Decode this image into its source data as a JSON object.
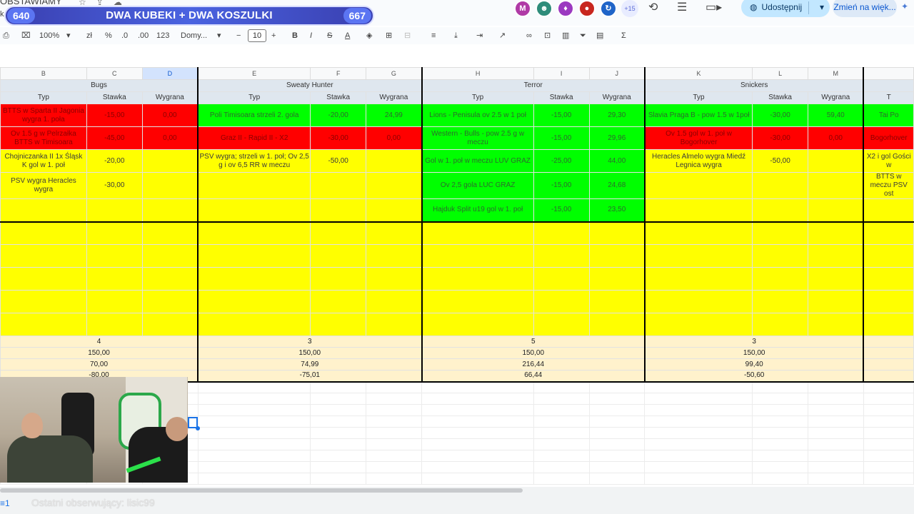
{
  "doc": {
    "title": "OBSTAWIAMY",
    "title_sub": "k"
  },
  "banner": {
    "left_num": "640",
    "text": "DWA KUBEKI + DWA KOSZULKI",
    "right_num": "667"
  },
  "collab": {
    "avatars": [
      {
        "letter": "M",
        "color": "#b03aa6"
      },
      {
        "letter": "☻",
        "color": "#2e8c7a"
      },
      {
        "letter": "♦",
        "color": "#9b39c0"
      },
      {
        "letter": "●",
        "color": "#c8261e"
      },
      {
        "letter": "↻",
        "color": "#1f64c8"
      }
    ],
    "more": "+15"
  },
  "header_actions": {
    "share_label": "Udostępnij",
    "change_label": "Zmień na więk..."
  },
  "toolbar": {
    "zoom": "100%",
    "currency": "zł",
    "percent": "%",
    "dec_less": ".0",
    "dec_more": ".00",
    "number_format": "123",
    "font": "Domy...",
    "font_size": "10",
    "bold": "B",
    "italic": "I",
    "strike": "S",
    "text_color": "A",
    "sigma": "Σ"
  },
  "columns": [
    "B",
    "C",
    "D",
    "E",
    "F",
    "G",
    "H",
    "I",
    "J",
    "K",
    "L",
    "M"
  ],
  "blocks": [
    {
      "name": "Bugs"
    },
    {
      "name": "Sweaty Hunter"
    },
    {
      "name": "Terror"
    },
    {
      "name": "Snickers"
    }
  ],
  "sub_headers": {
    "typ": "Typ",
    "stawka": "Stawka",
    "wygrana": "Wygrana",
    "next_partial": "T"
  },
  "bets": [
    {
      "cells": [
        {
          "t": "BTTS w Sparta II Jagonia wygra 1. poła",
          "c": "r"
        },
        {
          "t": "-15,00",
          "c": "r"
        },
        {
          "t": "0,00",
          "c": "r"
        },
        {
          "t": "Poli Timisoara strzeli 2. gola",
          "c": "g"
        },
        {
          "t": "-20,00",
          "c": "g"
        },
        {
          "t": "24,99",
          "c": "g"
        },
        {
          "t": "Lions - Penisula ov 2.5 w  1 poł",
          "c": "g"
        },
        {
          "t": "-15,00",
          "c": "g"
        },
        {
          "t": "29,30",
          "c": "g"
        },
        {
          "t": "Slavia Praga B - pow 1.5 w  1poł",
          "c": "g"
        },
        {
          "t": "-30,00",
          "c": "g"
        },
        {
          "t": "59,40",
          "c": "g"
        },
        {
          "t": "Tai Po",
          "c": "g"
        }
      ]
    },
    {
      "cells": [
        {
          "t": "Ov 1.5 g w Pelrzałka BTTS w Timisoara",
          "c": "r"
        },
        {
          "t": "-45,00",
          "c": "r"
        },
        {
          "t": "0,00",
          "c": "r"
        },
        {
          "t": "Graz II - Rapid II - X2",
          "c": "r"
        },
        {
          "t": "-30,00",
          "c": "r"
        },
        {
          "t": "0,00",
          "c": "r"
        },
        {
          "t": "Western - Bulls - pow 2.5 g w meczu",
          "c": "g"
        },
        {
          "t": "-15,00",
          "c": "g"
        },
        {
          "t": "29,96",
          "c": "g"
        },
        {
          "t": "Ov 1.5 gol w 1. poł w Bogorhover",
          "c": "r"
        },
        {
          "t": "-30,00",
          "c": "r"
        },
        {
          "t": "0,00",
          "c": "r"
        },
        {
          "t": "Bogorhover",
          "c": "r"
        }
      ]
    },
    {
      "cells": [
        {
          "t": "Chojniczanka II 1x Śląsk K gol w 1. poł",
          "c": "y"
        },
        {
          "t": "-20,00",
          "c": "y"
        },
        {
          "t": "",
          "c": "y"
        },
        {
          "t": "PSV wygra; strzeli w 1. poł; Ov 2,5 g i ov 6,5 RR w meczu",
          "c": "y"
        },
        {
          "t": "-50,00",
          "c": "y"
        },
        {
          "t": "",
          "c": "y"
        },
        {
          "t": "Gol w 1. poł w meczu LUV GRAZ",
          "c": "g"
        },
        {
          "t": "-25,00",
          "c": "g"
        },
        {
          "t": "44,00",
          "c": "g"
        },
        {
          "t": "Heracles Almelo wygra Miedź Legnica wygra",
          "c": "y"
        },
        {
          "t": "-50,00",
          "c": "y"
        },
        {
          "t": "",
          "c": "y"
        },
        {
          "t": "X2 i gol Gości w",
          "c": "y"
        }
      ]
    },
    {
      "cells": [
        {
          "t": "PSV wygra Heracles wygra",
          "c": "y"
        },
        {
          "t": "-30,00",
          "c": "y"
        },
        {
          "t": "",
          "c": "y"
        },
        {
          "t": "",
          "c": "y"
        },
        {
          "t": "",
          "c": "y"
        },
        {
          "t": "",
          "c": "y"
        },
        {
          "t": "Ov 2,5 gola LUC GRAZ",
          "c": "g"
        },
        {
          "t": "-15,00",
          "c": "g"
        },
        {
          "t": "24,68",
          "c": "g"
        },
        {
          "t": "",
          "c": "y"
        },
        {
          "t": "",
          "c": "y"
        },
        {
          "t": "",
          "c": "y"
        },
        {
          "t": "BTTS w meczu PSV ost",
          "c": "y"
        }
      ]
    },
    {
      "cells": [
        {
          "t": "",
          "c": "y"
        },
        {
          "t": "",
          "c": "y"
        },
        {
          "t": "",
          "c": "y"
        },
        {
          "t": "",
          "c": "y"
        },
        {
          "t": "",
          "c": "y"
        },
        {
          "t": "",
          "c": "y"
        },
        {
          "t": "Hajduk Split u19 gol w 1. poł",
          "c": "g"
        },
        {
          "t": "-15,00",
          "c": "g"
        },
        {
          "t": "23,50",
          "c": "g"
        },
        {
          "t": "",
          "c": "y"
        },
        {
          "t": "",
          "c": "y"
        },
        {
          "t": "",
          "c": "y"
        },
        {
          "t": "",
          "c": "y"
        }
      ]
    }
  ],
  "summary": [
    {
      "values": [
        "4",
        "3",
        "5",
        "3"
      ]
    },
    {
      "values": [
        "150,00",
        "150,00",
        "150,00",
        "150,00"
      ]
    },
    {
      "values": [
        "70,00",
        "74,99",
        "216,44",
        "99,40"
      ]
    },
    {
      "values": [
        "-80,00",
        "-75,01",
        "66,44",
        "-50,60"
      ]
    }
  ],
  "bottom": {
    "sheet_tab": "≡1",
    "ticker": "Ostatni obserwujący: lisic99"
  }
}
